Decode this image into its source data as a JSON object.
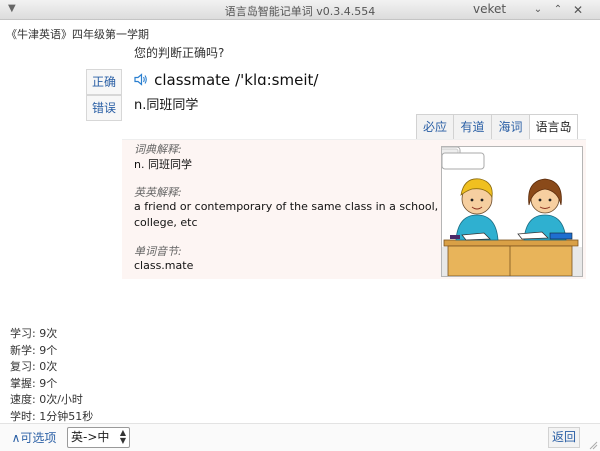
{
  "window": {
    "title": "语言岛智能记单词 v0.3.4.554",
    "user": "veket",
    "buttons": {
      "minimize": "⌄",
      "maximize": "⌃",
      "close": "✕"
    },
    "menu_arrow": "▼"
  },
  "book": "《牛津英语》四年级第一学期",
  "prompt": "您的判断正确吗?",
  "judge": {
    "correct": "正确",
    "wrong": "错误"
  },
  "word": {
    "text": "classmate",
    "phonetic": "/'klɑ:smeit/",
    "meaning": "n.同班同学",
    "speaker_icon": "speaker-icon"
  },
  "dict_tabs": [
    {
      "label": "必应",
      "active": false
    },
    {
      "label": "有道",
      "active": false
    },
    {
      "label": "海词",
      "active": false
    },
    {
      "label": "语言岛",
      "active": true
    }
  ],
  "content": {
    "dict_label": "词典解释:",
    "dict_text": "n. 同班同学",
    "en_label": "英英解释:",
    "en_text_1": "a friend or contemporary of the same class in a school,",
    "en_text_2": "college, etc",
    "syl_label": "单词音节:",
    "syl_text": "class.mate"
  },
  "stats": [
    "学习: 9次",
    "新学: 9个",
    "复习: 0次",
    "掌握: 9个",
    "速度: 0次/小时",
    "学时: 1分钟51秒"
  ],
  "bottom": {
    "options": "∧可选项",
    "lang_select": "英->中",
    "back": "返回"
  },
  "colors": {
    "link": "#2a5fa5",
    "content_bg": "#fdf5f3",
    "speaker": "#2a7fd0"
  }
}
